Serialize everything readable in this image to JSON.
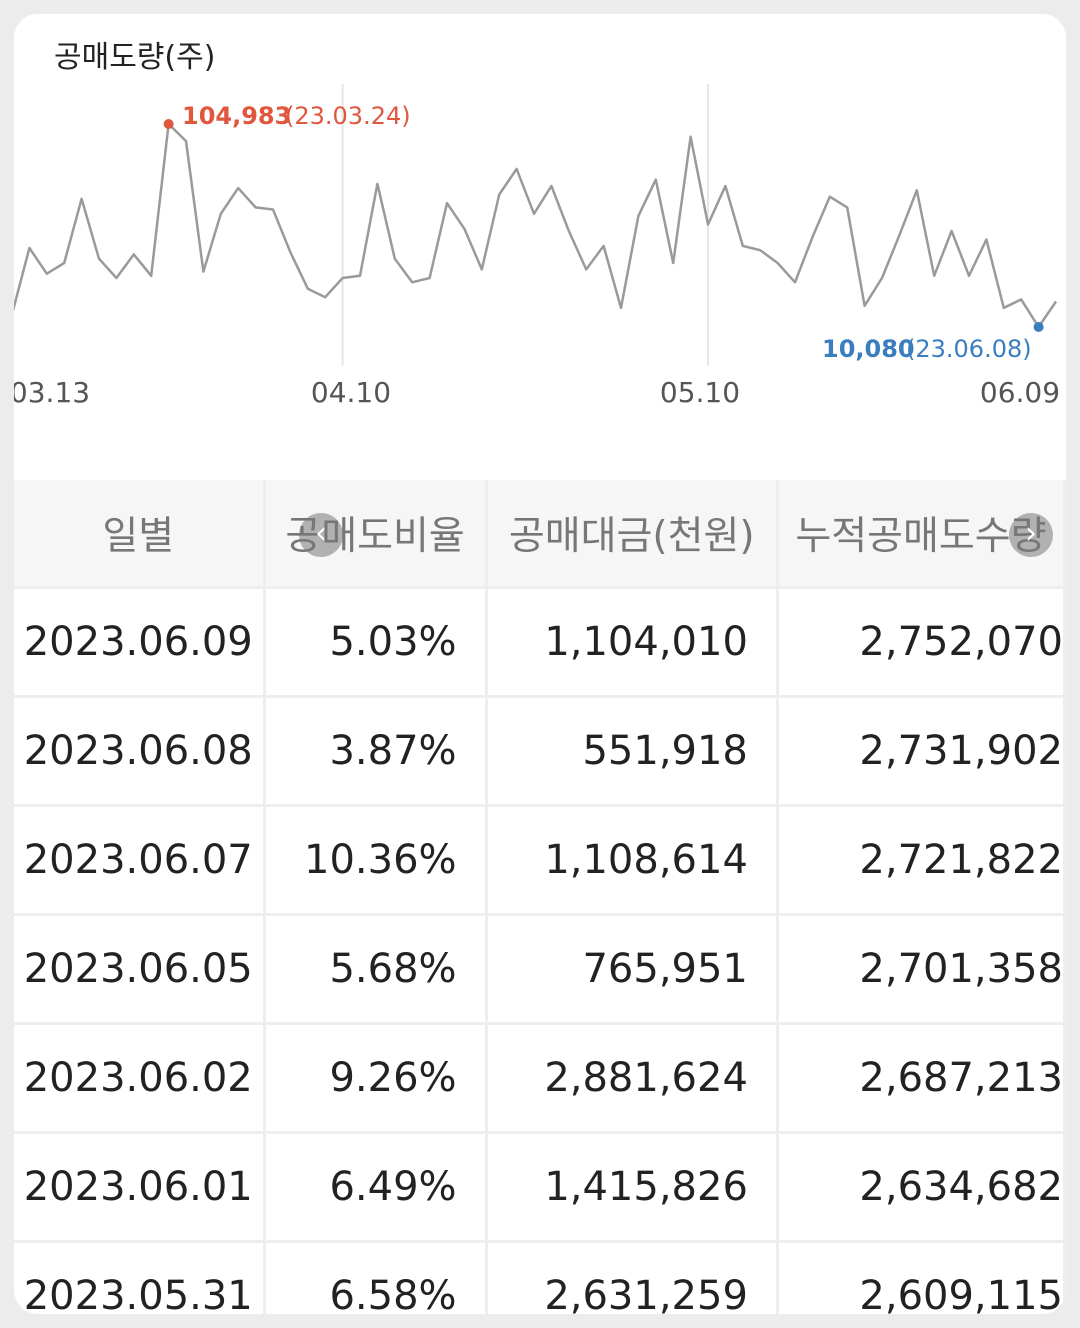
{
  "chart": {
    "title": "공매도량(주)",
    "max_value_label": "104,983",
    "max_date_label": "(23.03.24)",
    "min_value_label": "10,080",
    "min_date_label": "(23.06.08)",
    "x_ticks": [
      "03.13",
      "04.10",
      "05.10",
      "06.09"
    ],
    "colors": {
      "line": "#9a9a9a",
      "max": "#e0573e",
      "min": "#3b7ec0",
      "grid": "#e6e6e6",
      "tick": "#555555"
    }
  },
  "chart_data": {
    "type": "line",
    "ylabel": "공매도량(주)",
    "ylim": [
      0,
      115000
    ],
    "grid": "vertical at tick dates",
    "tick_labels": [
      "03.13",
      "04.10",
      "05.10",
      "06.09"
    ],
    "values": [
      16000,
      47000,
      35000,
      40000,
      70000,
      42000,
      33000,
      44000,
      34000,
      104983,
      97000,
      36000,
      63000,
      75000,
      66000,
      65000,
      45000,
      28000,
      24000,
      33000,
      34000,
      77000,
      42000,
      31000,
      33000,
      68000,
      56000,
      37000,
      72000,
      84000,
      63000,
      76000,
      55000,
      37000,
      48000,
      19000,
      62000,
      79000,
      40000,
      99000,
      58000,
      76000,
      48000,
      46000,
      40000,
      31000,
      52000,
      71000,
      66000,
      20000,
      33000,
      53000,
      74000,
      34000,
      55000,
      34000,
      51000,
      19000,
      23000,
      10080,
      22000
    ]
  },
  "table": {
    "headers": [
      "일별",
      "공매도비율",
      "공매대금(천원)",
      "누적공매도수량"
    ],
    "rows": [
      [
        "2023.06.09",
        "5.03%",
        "1,104,010",
        "2,752,070"
      ],
      [
        "2023.06.08",
        "3.87%",
        "551,918",
        "2,731,902"
      ],
      [
        "2023.06.07",
        "10.36%",
        "1,108,614",
        "2,721,822"
      ],
      [
        "2023.06.05",
        "5.68%",
        "765,951",
        "2,701,358"
      ],
      [
        "2023.06.02",
        "9.26%",
        "2,881,624",
        "2,687,213"
      ],
      [
        "2023.06.01",
        "6.49%",
        "1,415,826",
        "2,634,682"
      ],
      [
        "2023.05.31",
        "6.58%",
        "2,631,259",
        "2,609,115"
      ]
    ]
  },
  "scroll": {
    "left_icon": "chevron-left-icon",
    "right_icon": "chevron-right-icon"
  }
}
